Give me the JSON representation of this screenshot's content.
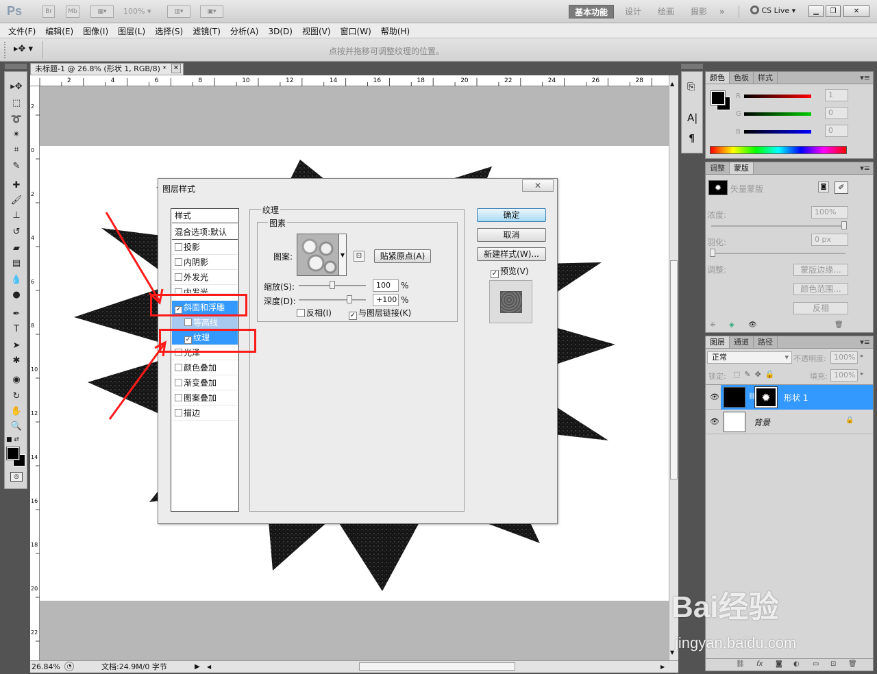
{
  "app": {
    "logo": "Ps",
    "zoom_select": "100%",
    "workspaces": [
      "基本功能",
      "设计",
      "绘画",
      "摄影"
    ],
    "more": "»",
    "cs_live": "CS Live"
  },
  "menu": [
    "文件(F)",
    "编辑(E)",
    "图像(I)",
    "图层(L)",
    "选择(S)",
    "滤镜(T)",
    "分析(A)",
    "3D(D)",
    "视图(V)",
    "窗口(W)",
    "帮助(H)"
  ],
  "options_bar": {
    "hint": "点按并拖移可调整纹理的位置。"
  },
  "document": {
    "tab_title": "未标题-1 @ 26.8% (形状 1, RGB/8) *",
    "ruler_top": [
      "2",
      "4",
      "6",
      "8",
      "10",
      "12",
      "14",
      "16",
      "18",
      "20",
      "22",
      "24",
      "26",
      "28"
    ],
    "ruler_left": [
      "2",
      "0",
      "2",
      "4",
      "6",
      "8",
      "10",
      "12",
      "14",
      "16",
      "18",
      "20",
      "22"
    ],
    "status_zoom": "26.84%",
    "status_doc": "文档:24.9M/0 字节"
  },
  "dialog": {
    "title": "图层样式",
    "style_items": [
      {
        "label": "样式"
      },
      {
        "label": "混合选项:默认"
      },
      {
        "label": "投影"
      },
      {
        "label": "内阴影"
      },
      {
        "label": "外发光"
      },
      {
        "label": "内发光"
      },
      {
        "label": "斜面和浮雕"
      },
      {
        "label": "等高线"
      },
      {
        "label": "纹理"
      },
      {
        "label": "光泽"
      },
      {
        "label": "颜色叠加"
      },
      {
        "label": "渐变叠加"
      },
      {
        "label": "图案叠加"
      },
      {
        "label": "描边"
      }
    ],
    "section_title": "纹理",
    "group_title": "图素",
    "pattern_label": "图案:",
    "snap_button": "贴紧原点(A)",
    "scale_label": "缩放(S):",
    "scale_value": "100",
    "scale_fraction": 0.5,
    "depth_label": "深度(D):",
    "depth_value": "+100",
    "depth_fraction": 0.75,
    "percent": "%",
    "invert_label": "反相(I)",
    "link_label": "与图层链接(K)",
    "ok": "确定",
    "cancel": "取消",
    "new_style": "新建样式(W)...",
    "preview": "预览(V)"
  },
  "color_panel": {
    "tabs": [
      "颜色",
      "色板",
      "样式"
    ],
    "channels": [
      {
        "name": "R",
        "value": "1"
      },
      {
        "name": "G",
        "value": "0"
      },
      {
        "name": "B",
        "value": "0"
      }
    ]
  },
  "adjust_panel": {
    "tabs": [
      "调整",
      "蒙版"
    ],
    "mask_type": "矢量蒙版",
    "density_label": "浓度:",
    "density_value": "100%",
    "feather_label": "羽化:",
    "feather_value": "0 px",
    "refine_label": "调整:",
    "btn_edge": "蒙版边缘...",
    "btn_range": "颜色范围...",
    "btn_invert": "反相"
  },
  "layers_panel": {
    "tabs": [
      "图层",
      "通道",
      "路径"
    ],
    "blend_mode": "正常",
    "opacity_label": "不透明度:",
    "opacity_value": "100%",
    "lock_label": "锁定:",
    "fill_label": "填充:",
    "fill_value": "100%",
    "layers": [
      {
        "name": "形状 1"
      },
      {
        "name": "背景"
      }
    ]
  },
  "watermark": {
    "brand": "Bai经验",
    "url": "jingyan.baidu.com"
  },
  "colors": {
    "selection": "#3399ff",
    "annotation": "#ff1a1a",
    "ok_button": "#a9dbf6"
  }
}
